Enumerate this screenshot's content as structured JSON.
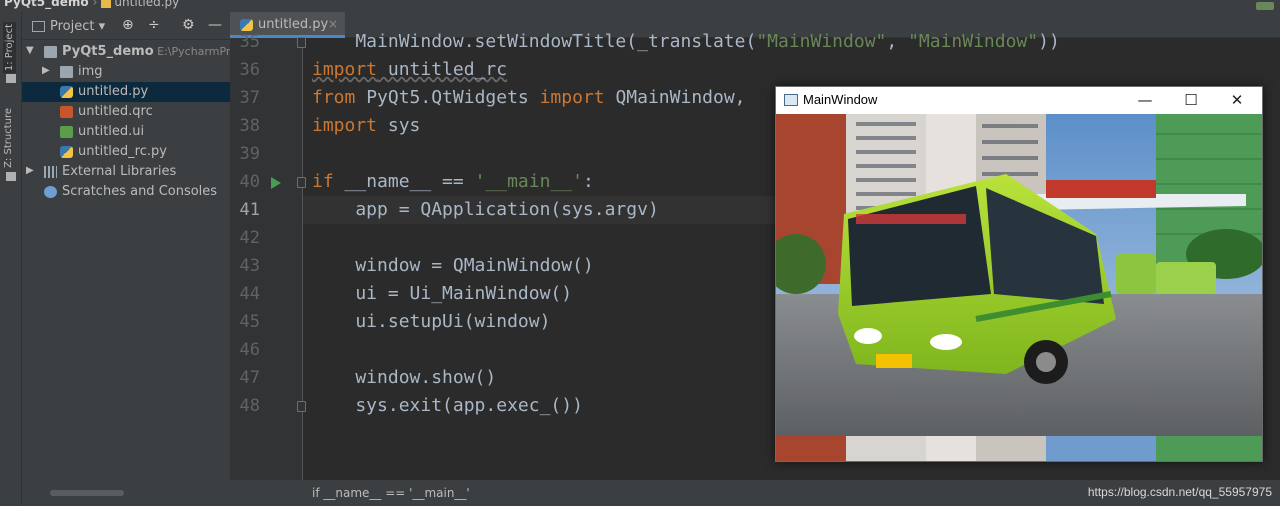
{
  "window": {
    "project_name": "PyQt5_demo",
    "open_file": "untitled.py"
  },
  "toolstrip": {
    "project_label": "1: Project",
    "structure_label": "Z: Structure"
  },
  "project_panel": {
    "title": "Project",
    "title_suffix": "▾",
    "tree": [
      {
        "arrow": "▼",
        "icon": "folder",
        "label": "PyQt5_demo",
        "hint": "E:\\PycharmPro",
        "indent": 0
      },
      {
        "arrow": "▶",
        "icon": "folder",
        "label": "img",
        "indent": 1
      },
      {
        "icon": "py",
        "label": "untitled.py",
        "indent": 1,
        "selected": true
      },
      {
        "icon": "qrc",
        "label": "untitled.qrc",
        "indent": 1
      },
      {
        "icon": "ui",
        "label": "untitled.ui",
        "indent": 1
      },
      {
        "icon": "py",
        "label": "untitled_rc.py",
        "indent": 1
      },
      {
        "arrow": "▶",
        "icon": "lib",
        "label": "External Libraries",
        "indent": 0
      },
      {
        "icon": "scratch",
        "label": "Scratches and Consoles",
        "indent": 0
      }
    ]
  },
  "editor": {
    "tab_label": "untitled.py",
    "tab_close": "×",
    "current_line": "41",
    "lines": [
      {
        "n": "35",
        "code": "    MainWindow.setWindowTitle(_translate(\"MainWindow\", \"MainWindow\"))"
      },
      {
        "n": "36",
        "code": "import untitled_rc"
      },
      {
        "n": "37",
        "code": "from PyQt5.QtWidgets import QMainWindow,"
      },
      {
        "n": "38",
        "code": "import sys"
      },
      {
        "n": "39",
        "code": ""
      },
      {
        "n": "40",
        "code": "if __name__ == '__main__':"
      },
      {
        "n": "41",
        "code": "    app = QApplication(sys.argv)"
      },
      {
        "n": "42",
        "code": ""
      },
      {
        "n": "43",
        "code": "    window = QMainWindow()"
      },
      {
        "n": "44",
        "code": "    ui = Ui_MainWindow()"
      },
      {
        "n": "45",
        "code": "    ui.setupUi(window)"
      },
      {
        "n": "46",
        "code": ""
      },
      {
        "n": "47",
        "code": "    window.show()"
      },
      {
        "n": "48",
        "code": "    sys.exit(app.exec_())"
      }
    ],
    "status_crumb": "if __name__ == '__main__'"
  },
  "qt_window": {
    "title": "MainWindow",
    "minimize": "—",
    "maximize": "☐",
    "close": "✕",
    "image_subject": "green city bus photo"
  },
  "watermark": "https://blog.csdn.net/qq_55957975",
  "colors": {
    "ide_bg": "#2b2b2b",
    "panel_bg": "#3c3f41",
    "keyword": "#cc7832",
    "string": "#6a8759",
    "selection": "#0d293e",
    "run_icon": "#499c54"
  }
}
